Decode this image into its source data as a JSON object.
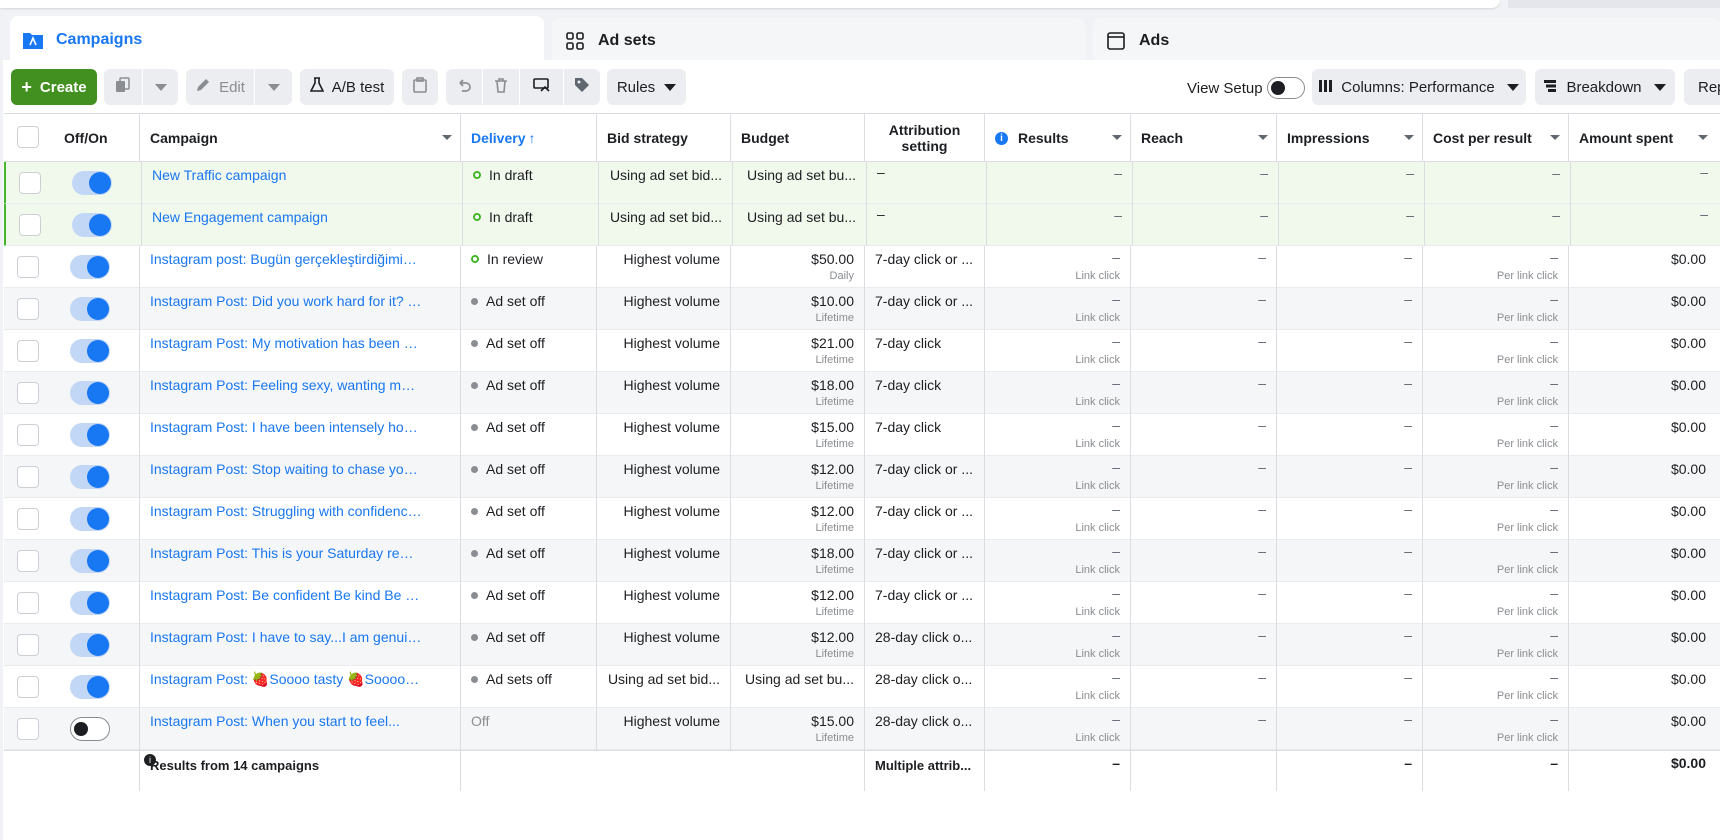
{
  "tabs": [
    {
      "label": "Campaigns"
    },
    {
      "label": "Ad sets"
    },
    {
      "label": "Ads"
    }
  ],
  "toolbar": {
    "create": "Create",
    "edit": "Edit",
    "ab_test": "A/B test",
    "rules": "Rules",
    "view_setup": "View Setup",
    "columns": "Columns: Performance",
    "breakdown": "Breakdown",
    "reports": "Rep"
  },
  "columns": [
    "Off/On",
    "Campaign",
    "Delivery",
    "Bid strategy",
    "Budget",
    "Attribution setting",
    "Results",
    "Reach",
    "Impressions",
    "Cost per result",
    "Amount spent"
  ],
  "delivery_sort_arrow": "↑",
  "dash": "–",
  "rows": [
    {
      "on": true,
      "campaign": "New Traffic campaign",
      "delivery": "In draft",
      "status": "draft",
      "bid": "Using ad set bid...",
      "budget": "Using ad set bu...",
      "budget_sub": "",
      "attribution": "–",
      "results": "–",
      "results_sub": "",
      "reach": "–",
      "impressions": "–",
      "cpr": "–",
      "cpr_sub": "",
      "spent": "–"
    },
    {
      "on": true,
      "campaign": "New Engagement campaign",
      "delivery": "In draft",
      "status": "draft",
      "bid": "Using ad set bid...",
      "budget": "Using ad set bu...",
      "budget_sub": "",
      "attribution": "–",
      "results": "–",
      "results_sub": "",
      "reach": "–",
      "impressions": "–",
      "cpr": "–",
      "cpr_sub": "",
      "spent": "–"
    },
    {
      "on": true,
      "campaign": "Instagram post: Bugün gerçekleştirdiğimiz Pu...",
      "delivery": "In review",
      "status": "review",
      "bid": "Highest volume",
      "budget": "$50.00",
      "budget_sub": "Daily",
      "attribution": "7-day click or ...",
      "results": "–",
      "results_sub": "Link click",
      "reach": "–",
      "impressions": "–",
      "cpr": "–",
      "cpr_sub": "Per link click",
      "spent": "$0.00"
    },
    {
      "on": true,
      "campaign": "Instagram Post: Did you work hard for it? The...",
      "delivery": "Ad set off",
      "status": "off",
      "bid": "Highest volume",
      "budget": "$10.00",
      "budget_sub": "Lifetime",
      "attribution": "7-day click or ...",
      "results": "–",
      "results_sub": "Link click",
      "reach": "–",
      "impressions": "–",
      "cpr": "–",
      "cpr_sub": "Per link click",
      "spent": "$0.00"
    },
    {
      "on": true,
      "campaign": "Instagram Post: My motivation has been gon...",
      "delivery": "Ad set off",
      "status": "off",
      "bid": "Highest volume",
      "budget": "$21.00",
      "budget_sub": "Lifetime",
      "attribution": "7-day click",
      "results": "–",
      "results_sub": "Link click",
      "reach": "–",
      "impressions": "–",
      "cpr": "–",
      "cpr_sub": "Per link click",
      "spent": "$0.00"
    },
    {
      "on": true,
      "campaign": "Instagram Post: Feeling sexy, wanting more i...",
      "delivery": "Ad set off",
      "status": "off",
      "bid": "Highest volume",
      "budget": "$18.00",
      "budget_sub": "Lifetime",
      "attribution": "7-day click",
      "results": "–",
      "results_sub": "Link click",
      "reach": "–",
      "impressions": "–",
      "cpr": "–",
      "cpr_sub": "Per link click",
      "spent": "$0.00"
    },
    {
      "on": true,
      "campaign": "Instagram Post: I have been intensely honing ...",
      "delivery": "Ad set off",
      "status": "off",
      "bid": "Highest volume",
      "budget": "$15.00",
      "budget_sub": "Lifetime",
      "attribution": "7-day click",
      "results": "–",
      "results_sub": "Link click",
      "reach": "–",
      "impressions": "–",
      "cpr": "–",
      "cpr_sub": "Per link click",
      "spent": "$0.00"
    },
    {
      "on": true,
      "campaign": "Instagram Post: Stop waiting to chase your...",
      "delivery": "Ad set off",
      "status": "off",
      "bid": "Highest volume",
      "budget": "$12.00",
      "budget_sub": "Lifetime",
      "attribution": "7-day click or ...",
      "results": "–",
      "results_sub": "Link click",
      "reach": "–",
      "impressions": "–",
      "cpr": "–",
      "cpr_sub": "Per link click",
      "spent": "$0.00"
    },
    {
      "on": true,
      "campaign": "Instagram Post: Struggling with confidence??...",
      "delivery": "Ad set off",
      "status": "off",
      "bid": "Highest volume",
      "budget": "$12.00",
      "budget_sub": "Lifetime",
      "attribution": "7-day click or ...",
      "results": "–",
      "results_sub": "Link click",
      "reach": "–",
      "impressions": "–",
      "cpr": "–",
      "cpr_sub": "Per link click",
      "spent": "$0.00"
    },
    {
      "on": true,
      "campaign": "Instagram Post: This is your Saturday remind...",
      "delivery": "Ad set off",
      "status": "off",
      "bid": "Highest volume",
      "budget": "$18.00",
      "budget_sub": "Lifetime",
      "attribution": "7-day click or ...",
      "results": "–",
      "results_sub": "Link click",
      "reach": "–",
      "impressions": "–",
      "cpr": "–",
      "cpr_sub": "Per link click",
      "spent": "$0.00"
    },
    {
      "on": true,
      "campaign": "Instagram Post: Be confident Be kind Be lovin...",
      "delivery": "Ad set off",
      "status": "off",
      "bid": "Highest volume",
      "budget": "$12.00",
      "budget_sub": "Lifetime",
      "attribution": "7-day click or ...",
      "results": "–",
      "results_sub": "Link click",
      "reach": "–",
      "impressions": "–",
      "cpr": "–",
      "cpr_sub": "Per link click",
      "spent": "$0.00"
    },
    {
      "on": true,
      "campaign": "Instagram Post: I have to say...I am genuinely...",
      "delivery": "Ad set off",
      "status": "off",
      "bid": "Highest volume",
      "budget": "$12.00",
      "budget_sub": "Lifetime",
      "attribution": "28-day click o...",
      "results": "–",
      "results_sub": "Link click",
      "reach": "–",
      "impressions": "–",
      "cpr": "–",
      "cpr_sub": "Per link click",
      "spent": "$0.00"
    },
    {
      "on": true,
      "campaign": "Instagram Post: 🍓Soooo tasty 🍓Soooo be...",
      "delivery": "Ad sets off",
      "status": "off",
      "bid": "Using ad set bid...",
      "budget": "Using ad set bu...",
      "budget_sub": "",
      "attribution": "28-day click o...",
      "results": "–",
      "results_sub": "Link click",
      "reach": "–",
      "impressions": "–",
      "cpr": "–",
      "cpr_sub": "Per link click",
      "spent": "$0.00"
    },
    {
      "on": false,
      "campaign": "Instagram Post: When you start to feel...",
      "delivery": "Off",
      "status": "plain",
      "bid": "Highest volume",
      "budget": "$15.00",
      "budget_sub": "Lifetime",
      "attribution": "28-day click o...",
      "results": "–",
      "results_sub": "Link click",
      "reach": "–",
      "impressions": "–",
      "cpr": "–",
      "cpr_sub": "Per link click",
      "spent": "$0.00"
    }
  ],
  "footer": {
    "label": "Results from 14 campaigns",
    "attribution": "Multiple attrib...",
    "results": "–",
    "impressions": "–",
    "cpr": "–",
    "spent": "$0.00"
  },
  "colors": {
    "accent": "#1877f2",
    "create_green": "#42901f",
    "draft_row": "#f1f8ec"
  }
}
